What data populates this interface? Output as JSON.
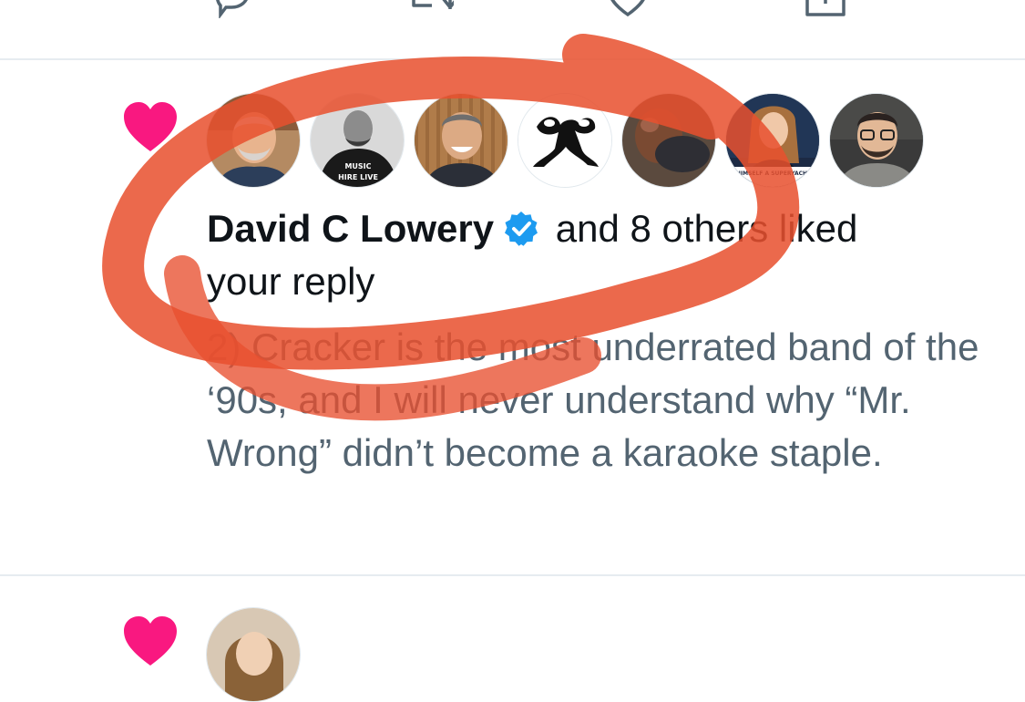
{
  "notification": {
    "actor_name": "David C Lowery",
    "verified": true,
    "action_text": "and 8 others liked your reply",
    "reply_text": "2) Cracker is the most underrated band of the ‘90s, and I will never understand why “Mr. Wrong” didn’t become a karaoke staple.",
    "avatar_badges": [
      "SUPPORT LIVE MUSIC HIRE LIVE MUSICIANS",
      "HIMSELF A SUPERYACHT"
    ]
  },
  "icons": {
    "top_actions": [
      "reply-icon",
      "retweet-icon",
      "like-icon",
      "share-icon"
    ],
    "notification_type": "heart-icon",
    "verified": "verified-badge-icon"
  },
  "colors": {
    "heart": "#f91880",
    "verified": "#1d9bf0",
    "annotation": "#e8502f",
    "secondary_text": "#536471",
    "primary_text": "#0f1419"
  }
}
